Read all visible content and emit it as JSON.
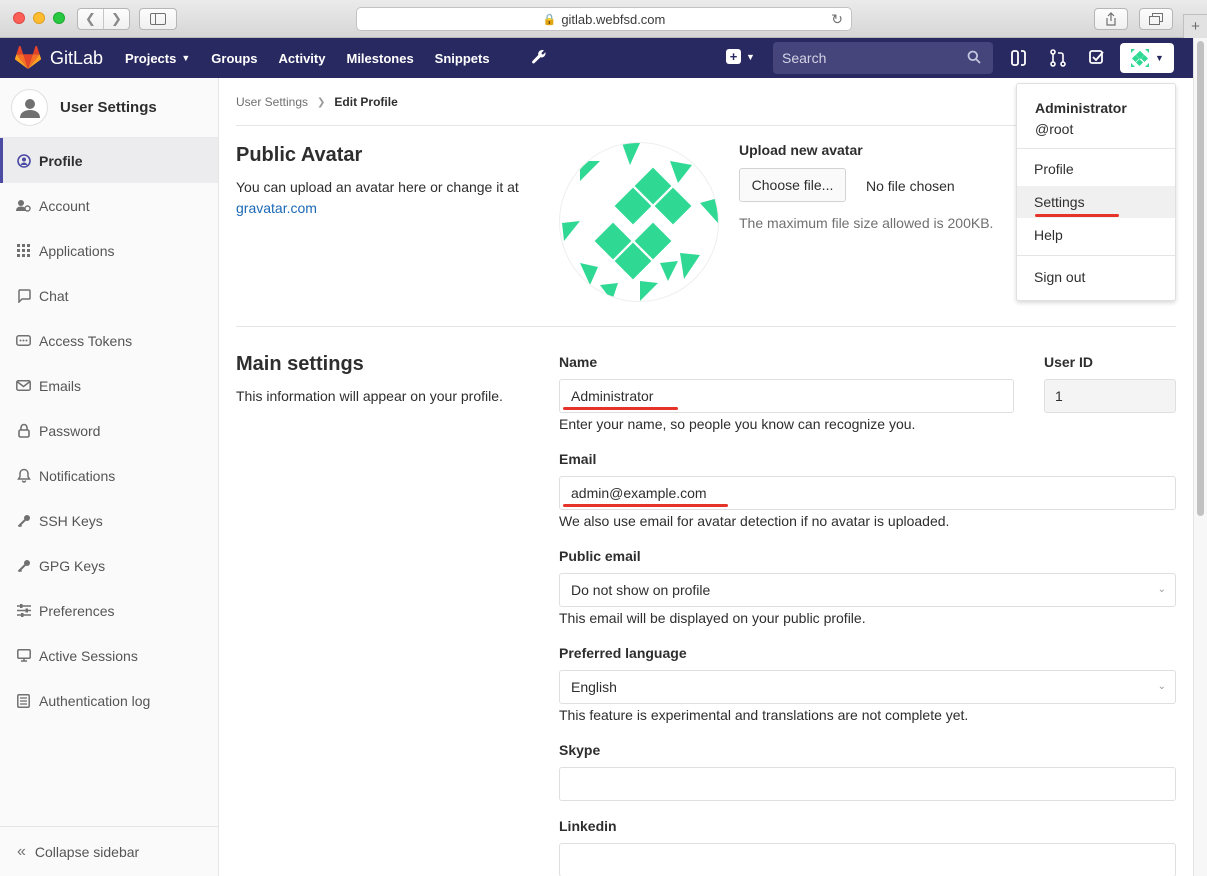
{
  "browser": {
    "url": "gitlab.webfsd.com"
  },
  "header": {
    "logo_text": "GitLab",
    "nav": [
      {
        "label": "Projects",
        "has_caret": true
      },
      {
        "label": "Groups"
      },
      {
        "label": "Activity"
      },
      {
        "label": "Milestones"
      },
      {
        "label": "Snippets"
      }
    ],
    "search_placeholder": "Search",
    "background": "#292961"
  },
  "sidebar": {
    "title": "User Settings",
    "items": [
      {
        "label": "Profile",
        "icon": "profile-icon",
        "active": true
      },
      {
        "label": "Account",
        "icon": "account-icon"
      },
      {
        "label": "Applications",
        "icon": "applications-icon"
      },
      {
        "label": "Chat",
        "icon": "chat-icon"
      },
      {
        "label": "Access Tokens",
        "icon": "access-tokens-icon"
      },
      {
        "label": "Emails",
        "icon": "email-icon"
      },
      {
        "label": "Password",
        "icon": "lock-icon"
      },
      {
        "label": "Notifications",
        "icon": "bell-icon"
      },
      {
        "label": "SSH Keys",
        "icon": "key-icon"
      },
      {
        "label": "GPG Keys",
        "icon": "key-icon"
      },
      {
        "label": "Preferences",
        "icon": "preferences-icon"
      },
      {
        "label": "Active Sessions",
        "icon": "monitor-icon"
      },
      {
        "label": "Authentication log",
        "icon": "log-icon"
      }
    ],
    "collapse_label": "Collapse sidebar"
  },
  "breadcrumb": {
    "parent": "User Settings",
    "current": "Edit Profile"
  },
  "avatar_section": {
    "title": "Public Avatar",
    "desc_prefix": "You can upload an avatar here or change it at",
    "link": "gravatar.com",
    "upload_title": "Upload new avatar",
    "choose_button": "Choose file...",
    "no_file": "No file chosen",
    "max_size": "The maximum file size allowed is 200KB."
  },
  "main_settings": {
    "title": "Main settings",
    "desc": "This information will appear on your profile.",
    "name_label": "Name",
    "name_value": "Administrator",
    "name_help": "Enter your name, so people you know can recognize you.",
    "userid_label": "User ID",
    "userid_value": "1",
    "email_label": "Email",
    "email_value": "admin@example.com",
    "email_help": "We also use email for avatar detection if no avatar is uploaded.",
    "public_email_label": "Public email",
    "public_email_value": "Do not show on profile",
    "public_email_help": "This email will be displayed on your public profile.",
    "language_label": "Preferred language",
    "language_value": "English",
    "language_help": "This feature is experimental and translations are not complete yet.",
    "skype_label": "Skype",
    "skype_value": "",
    "linkedin_label": "Linkedin",
    "linkedin_value": ""
  },
  "user_dropdown": {
    "name": "Administrator",
    "username": "@root",
    "items": [
      "Profile",
      "Settings",
      "Help"
    ],
    "sign_out": "Sign out",
    "highlighted": "Settings"
  },
  "colors": {
    "accent": "#4b4ba3",
    "avatar_green": "#2fd994",
    "annotation_red": "#e5332a",
    "link": "#1b69b6"
  }
}
